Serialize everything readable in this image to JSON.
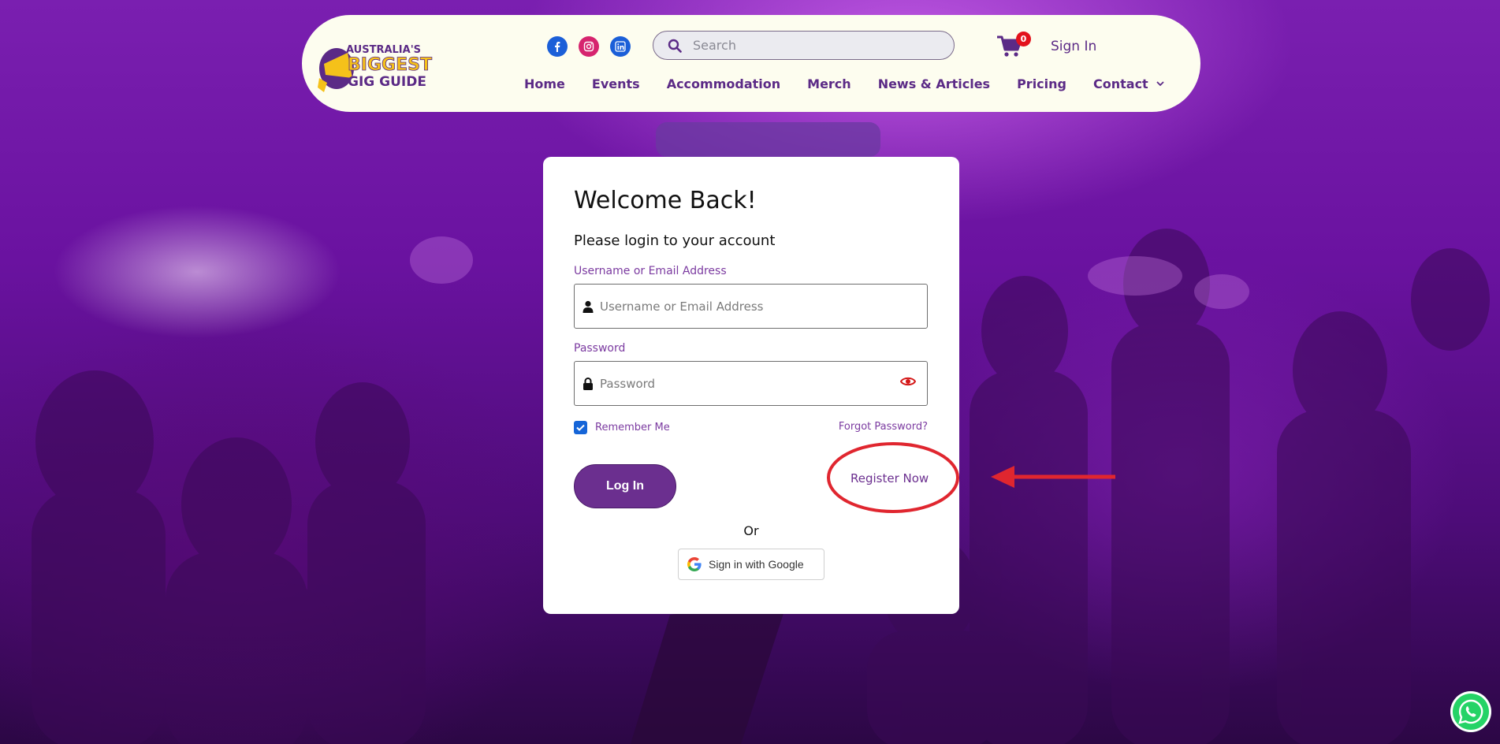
{
  "header": {
    "social": [
      {
        "name": "facebook-icon",
        "color": "#1b5fd8"
      },
      {
        "name": "instagram-icon",
        "color": "#d6246e"
      },
      {
        "name": "linkedin-icon",
        "color": "#1b5fd8"
      }
    ],
    "search_placeholder": "Search",
    "cart_count": "0",
    "sign_in": "Sign In",
    "nav": [
      "Home",
      "Events",
      "Accommodation",
      "Merch",
      "News & Articles",
      "Pricing",
      "Contact"
    ]
  },
  "login": {
    "title": "Welcome Back!",
    "subtitle": "Please login to your account",
    "username_label": "Username or Email Address",
    "username_placeholder": "Username or Email Address",
    "password_label": "Password",
    "password_placeholder": "Password",
    "remember_me": "Remember Me",
    "remember_checked": true,
    "forgot_password": "Forgot Password?",
    "login_button": "Log In",
    "register_link": "Register Now",
    "or_text": "Or",
    "google_button": "Sign in with Google"
  },
  "colors": {
    "brand_purple": "#6b2f8f",
    "header_bg": "#fdfdef",
    "annotation_red": "#e0262f",
    "whatsapp": "#25d366"
  }
}
